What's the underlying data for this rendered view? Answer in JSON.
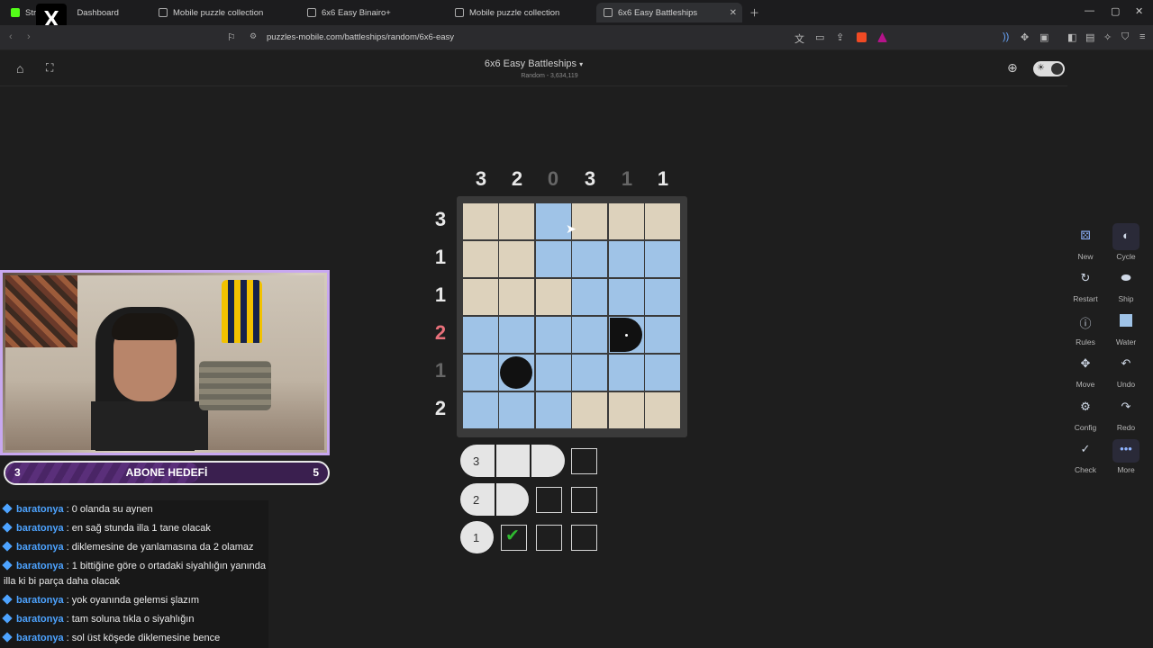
{
  "browser": {
    "tabs": [
      {
        "label": "Stre",
        "extra": "Dashboard"
      },
      {
        "label": "Mobile puzzle collection"
      },
      {
        "label": "6x6 Easy Binairo+"
      },
      {
        "label": "Mobile puzzle collection"
      },
      {
        "label": "6x6 Easy Battleships"
      }
    ],
    "url": "puzzles-mobile.com/battleships/random/6x6-easy"
  },
  "header": {
    "title": "6x6 Easy Battleships",
    "subtitle": "Random - 3,634,119"
  },
  "puzzle": {
    "col_clues": [
      "3",
      "2",
      "0",
      "3",
      "1",
      "1"
    ],
    "row_clues": [
      "3",
      "1",
      "1",
      "2",
      "1",
      "2"
    ],
    "fleet": [
      {
        "size": "3"
      },
      {
        "size": "2"
      },
      {
        "size": "1"
      }
    ]
  },
  "sidebar": {
    "new": "New",
    "cycle": "Cycle",
    "restart": "Restart",
    "ship": "Ship",
    "rules": "Rules",
    "water": "Water",
    "move": "Move",
    "undo": "Undo",
    "config": "Config",
    "redo": "Redo",
    "check": "Check",
    "more": "More"
  },
  "stream": {
    "goal_label": "ABONE HEDEFİ",
    "goal_current": "3",
    "goal_target": "5",
    "goal_progress": 0.6,
    "chat": [
      {
        "user": "baratonya",
        "msg": " : 0 olanda su aynen"
      },
      {
        "user": "baratonya",
        "msg": " : en sağ stunda illa 1 tane olacak"
      },
      {
        "user": "baratonya",
        "msg": " : diklemesine de yanlamasına da 2 olamaz"
      },
      {
        "user": "baratonya",
        "msg": " : 1 bittiğine göre o ortadaki siyahlığın yanında illa ki bi parça daha olacak"
      },
      {
        "user": "baratonya",
        "msg": " : yok oyanında gelemsi şlazım"
      },
      {
        "user": "baratonya",
        "msg": " : tam soluna tıkla o siyahlığın"
      },
      {
        "user": "baratonya",
        "msg": " : sol üst köşede diklemesine bence"
      }
    ]
  }
}
